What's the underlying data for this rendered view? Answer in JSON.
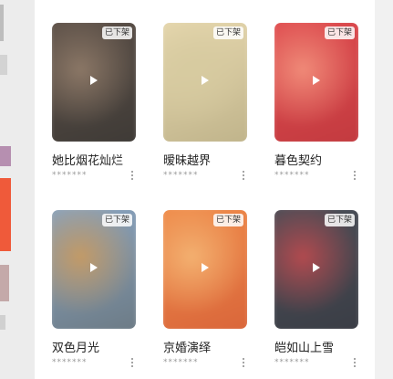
{
  "items": [
    {
      "title": "她比烟花灿烂",
      "badge": "已下架",
      "author": "*******",
      "thumb_colors": [
        "#5c5048",
        "#8b7766",
        "#3e3a36"
      ]
    },
    {
      "title": "暧昧越界",
      "badge": "已下架",
      "author": "*******",
      "thumb_colors": [
        "#e8d9b0",
        "#d7cba0",
        "#bfb38a"
      ]
    },
    {
      "title": "暮色契约",
      "badge": "已下架",
      "author": "*******",
      "thumb_colors": [
        "#e04b4f",
        "#f08a78",
        "#c23a3f"
      ]
    },
    {
      "title": "双色月光",
      "badge": "已下架",
      "author": "*******",
      "thumb_colors": [
        "#8aa6c4",
        "#c39a66",
        "#6c7a84"
      ]
    },
    {
      "title": "京婚演绎",
      "badge": "已下架",
      "author": "*******",
      "thumb_colors": [
        "#f08c4a",
        "#f3b070",
        "#d9653a"
      ]
    },
    {
      "title": "皑如山上雪",
      "badge": "已下架",
      "author": "*******",
      "thumb_colors": [
        "#4a4f58",
        "#b24a4f",
        "#3a3d45"
      ]
    }
  ]
}
